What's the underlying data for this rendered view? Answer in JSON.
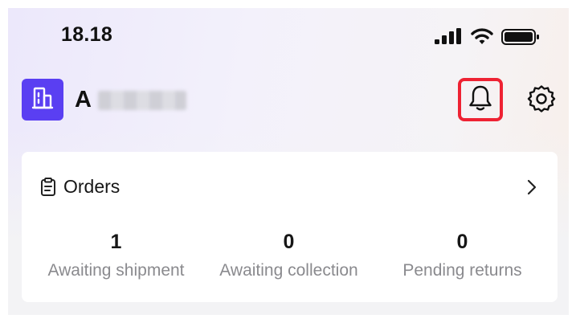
{
  "status_bar": {
    "time": "18.18",
    "icons": [
      "signal-icon",
      "wifi-icon",
      "battery-icon"
    ]
  },
  "header": {
    "store_initial": "A",
    "store_avatar_icon": "building-icon",
    "notifications_icon": "bell-icon",
    "settings_icon": "gear-icon",
    "highlight_color": "#ee2233",
    "avatar_color": "#5a3ff2"
  },
  "orders": {
    "title": "Orders",
    "icon": "clipboard-icon",
    "chevron_icon": "chevron-right-icon",
    "stats": [
      {
        "value": "1",
        "label": "Awaiting shipment"
      },
      {
        "value": "0",
        "label": "Awaiting collection"
      },
      {
        "value": "0",
        "label": "Pending returns"
      }
    ]
  }
}
